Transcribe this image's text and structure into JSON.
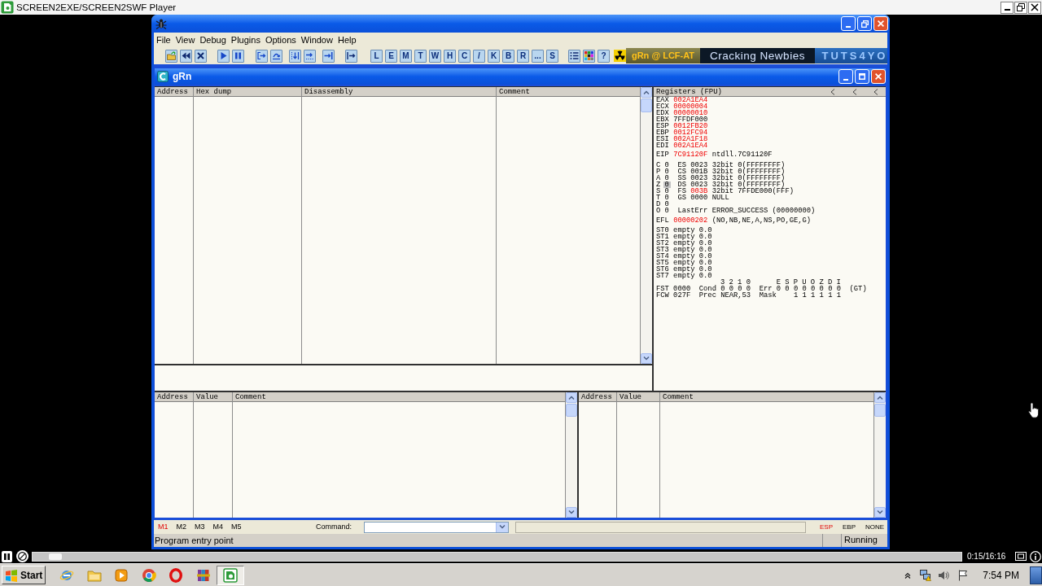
{
  "player": {
    "title": "SCREEN2EXE/SCREEN2SWF Player"
  },
  "debugger": {
    "menu": [
      "File",
      "View",
      "Debug",
      "Plugins",
      "Options",
      "Window",
      "Help"
    ],
    "toolbar": [
      [
        {
          "kind": "open"
        },
        {
          "kind": "restart"
        },
        {
          "kind": "close"
        }
      ],
      [
        {
          "kind": "run"
        },
        {
          "kind": "pause"
        }
      ],
      [
        {
          "kind": "step_into"
        },
        {
          "kind": "step_over"
        }
      ],
      [
        {
          "kind": "trace_into"
        },
        {
          "kind": "trace_over"
        }
      ],
      [
        {
          "kind": "till_return"
        }
      ],
      [
        {
          "kind": "goto"
        }
      ],
      [
        {
          "kind": "letter",
          "label": "L"
        },
        {
          "kind": "letter",
          "label": "E"
        },
        {
          "kind": "letter",
          "label": "M"
        },
        {
          "kind": "letter",
          "label": "T"
        },
        {
          "kind": "letter",
          "label": "W"
        },
        {
          "kind": "letter",
          "label": "H"
        },
        {
          "kind": "letter",
          "label": "C"
        },
        {
          "kind": "letter",
          "label": "/"
        },
        {
          "kind": "letter",
          "label": "K"
        },
        {
          "kind": "letter",
          "label": "B"
        },
        {
          "kind": "letter",
          "label": "R"
        },
        {
          "kind": "letter",
          "label": "..."
        },
        {
          "kind": "letter",
          "label": "S"
        }
      ],
      [
        {
          "kind": "list"
        },
        {
          "kind": "palette"
        },
        {
          "kind": "letter",
          "label": "?"
        }
      ]
    ],
    "banners": [
      {
        "kind": "radiation"
      },
      {
        "kind": "logo_gold",
        "text": "gRn @ LCF-AT"
      },
      {
        "kind": "logo_dark",
        "text": "Cracking Newbies"
      },
      {
        "kind": "logo_blue",
        "text": "TUTS4YO"
      }
    ],
    "child_window": {
      "title": "gRn"
    },
    "disassembly": {
      "columns": [
        "Address",
        "Hex dump",
        "Disassembly",
        "Comment"
      ]
    },
    "registers": {
      "title": "Registers (FPU)",
      "general": [
        {
          "name": "EAX",
          "value": "002A1EA4",
          "changed": true
        },
        {
          "name": "ECX",
          "value": "00000004",
          "changed": true
        },
        {
          "name": "EDX",
          "value": "00000010",
          "changed": true
        },
        {
          "name": "EBX",
          "value": "7FFDF000",
          "changed": false
        },
        {
          "name": "ESP",
          "value": "0012FB20",
          "changed": true
        },
        {
          "name": "EBP",
          "value": "0012FC94",
          "changed": true
        },
        {
          "name": "ESI",
          "value": "002A1F18",
          "changed": true
        },
        {
          "name": "EDI",
          "value": "002A1EA4",
          "changed": true
        }
      ],
      "eip": {
        "name": "EIP",
        "value": "7C91120F",
        "changed": true,
        "info": "ntdll.7C91120F"
      },
      "flags": [
        {
          "flag": "C",
          "bit": "0",
          "selected": false,
          "segment": {
            "name": "ES",
            "selector": "0023",
            "changed": false,
            "info": "32bit 0(FFFFFFFF)"
          }
        },
        {
          "flag": "P",
          "bit": "0",
          "selected": false,
          "segment": {
            "name": "CS",
            "selector": "001B",
            "changed": false,
            "info": "32bit 0(FFFFFFFF)"
          }
        },
        {
          "flag": "A",
          "bit": "0",
          "selected": false,
          "segment": {
            "name": "SS",
            "selector": "0023",
            "changed": false,
            "info": "32bit 0(FFFFFFFF)"
          }
        },
        {
          "flag": "Z",
          "bit": "0",
          "selected": true,
          "segment": {
            "name": "DS",
            "selector": "0023",
            "changed": false,
            "info": "32bit 0(FFFFFFFF)"
          }
        },
        {
          "flag": "S",
          "bit": "0",
          "selected": false,
          "segment": {
            "name": "FS",
            "selector": "003B",
            "changed": true,
            "info": "32bit 7FFDE000(FFF)"
          }
        },
        {
          "flag": "T",
          "bit": "0",
          "selected": false,
          "segment": {
            "name": "GS",
            "selector": "0000",
            "changed": false,
            "info": "NULL"
          }
        },
        {
          "flag": "D",
          "bit": "0",
          "selected": false
        },
        {
          "flag": "O",
          "bit": "0",
          "selected": false,
          "last_error": "LastErr ERROR_SUCCESS (00000000)"
        }
      ],
      "efl": {
        "name": "EFL",
        "value": "00000202",
        "changed": true,
        "info": "(NO,NB,NE,A,NS,PO,GE,G)"
      },
      "fpu": [
        "ST0 empty 0.0",
        "ST1 empty 0.0",
        "ST2 empty 0.0",
        "ST3 empty 0.0",
        "ST4 empty 0.0",
        "ST5 empty 0.0",
        "ST6 empty 0.0",
        "ST7 empty 0.0"
      ],
      "fpu_status": [
        {
          "kind": "bit_header",
          "text": "3 2 1 0      E S P U O Z D I"
        },
        {
          "kind": "line",
          "text": "FST 0000  Cond 0 0 0 0  Err 0 0 0 0 0 0 0 0  (GT)"
        },
        {
          "kind": "line",
          "text": "FCW 027F  Prec NEAR,53  Mask    1 1 1 1 1 1"
        }
      ]
    },
    "dump": {
      "columns": [
        "Address",
        "Value",
        "Comment"
      ]
    },
    "stack": {
      "columns": [
        "Address",
        "Value",
        "Comment"
      ]
    },
    "markers": [
      {
        "label": "M1",
        "selected": true
      },
      {
        "label": "M2",
        "selected": false
      },
      {
        "label": "M3",
        "selected": false
      },
      {
        "label": "M4",
        "selected": false
      },
      {
        "label": "M5",
        "selected": false
      }
    ],
    "command": {
      "label": "Command:"
    },
    "stack_modes": [
      {
        "label": "ESP",
        "selected": true
      },
      {
        "label": "EBP",
        "selected": false
      },
      {
        "label": "NONE",
        "selected": false
      }
    ],
    "status": {
      "message": "Program entry point",
      "state": "Running"
    }
  },
  "playback": {
    "level": 0.018,
    "time": "0:15/16:16"
  },
  "taskbar": {
    "start": "Start",
    "apps": [
      {
        "kind": "browser_e",
        "selected": false
      },
      {
        "kind": "folder",
        "selected": false
      },
      {
        "kind": "media",
        "selected": false
      },
      {
        "kind": "wheel",
        "selected": false
      },
      {
        "kind": "ring",
        "selected": false
      },
      {
        "kind": "archive",
        "selected": false
      },
      {
        "kind": "player",
        "selected": true
      }
    ],
    "clock": "7:54 PM"
  }
}
